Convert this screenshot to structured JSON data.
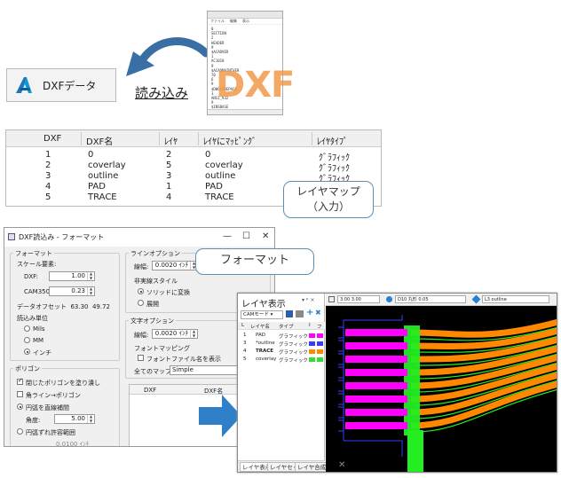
{
  "dxf_button": {
    "label": "DXFデータ"
  },
  "load_label": "読み込み",
  "thumbnail": {
    "menu": [
      "ファイル",
      "編集",
      "表示"
    ],
    "lines": [
      "0",
      "SECTION",
      "2",
      "HEADER",
      "9",
      "$ACADVER",
      "1",
      "AC1018",
      "9",
      "$ACADMAINTVER",
      "70",
      "6",
      "9",
      "$DWGCODEPAGE",
      "3",
      "ANSI_932",
      "9",
      "$INSBASE"
    ],
    "big_text": "DXF"
  },
  "layer_table": {
    "headers": [
      "DXF",
      "DXF名",
      "ﾚｲﾔ",
      "ﾚｲﾔにﾏｯﾋﾟﾝｸﾞ",
      "ﾚｲﾔﾀｲﾌﾟ"
    ],
    "rows": [
      [
        "1",
        "0",
        "2",
        "0",
        "ｸﾞﾗﾌｨｯｸ"
      ],
      [
        "2",
        "coverlay",
        "5",
        "coverlay",
        "ｸﾞﾗﾌｨｯｸ"
      ],
      [
        "3",
        "outline",
        "3",
        "outline",
        "ｸﾞﾗﾌｨｯｸ"
      ],
      [
        "4",
        "PAD",
        "1",
        "PAD",
        "ｸﾞﾗﾌｨｯｸ"
      ],
      [
        "5",
        "TRACE",
        "4",
        "TRACE",
        "ｸﾞﾗﾌｨｯｸ"
      ]
    ]
  },
  "callout_layer_map": {
    "line1": "レイヤマップ",
    "line2": "（入力）"
  },
  "callout_format": {
    "label": "フォーマット"
  },
  "dialog": {
    "title": "DXF読込み - フォーマット",
    "format_group": "フォーマット",
    "scale_factor": "スケール要素:",
    "dxf_label": "DXF:",
    "dxf_value": "1.00",
    "cam_label": "CAM350:",
    "cam_value": "0.23",
    "data_offset_label": "データオフセット",
    "data_offset_x": "63.30",
    "data_offset_y": "49.72",
    "units_label": "読込み単位",
    "unit_mils": "Mils",
    "unit_mm": "MM",
    "unit_inch": "インチ",
    "polygon_group": "ポリゴン",
    "fill_closed": "閉じたポリゴンを塗り潰し",
    "corner_to_poly": "角ライン→ポリゴン",
    "arc_to_line": "円弧を直線補間",
    "angle_label": "角度:",
    "angle_value": "5.00",
    "arc_tolerance": "円弧ずれ許容範囲",
    "arc_tol_value": "0.0100 ｲﾝﾁ",
    "line_option_group": "ラインオプション",
    "line_width_label": "線幅:",
    "line_width_value": "0.0020 ｲﾝﾁ",
    "non_solid_style": "非実線スタイル",
    "convert_solid": "ソリッドに変換",
    "expand": "展開",
    "text_option_group": "文字オプション",
    "text_width_label": "線幅:",
    "text_width_value": "0.0020 ｲﾝﾁ",
    "font_mapping": "フォントマッピング",
    "show_font_name": "フォントファイル名を表示",
    "all_map_label": "全てのマップ先:",
    "all_map_value": "Simple",
    "grid_dxf": "DXF",
    "grid_dxf_name": "DXF名",
    "minimize": "—",
    "maximize": "☐",
    "close": "✕"
  },
  "layer_window": {
    "title": "レイヤ表示",
    "pin": "▾ ᵖ ×",
    "mode": "CAMモード",
    "col_headers": [
      "L",
      "レイヤ名",
      "タイプ",
      "I",
      "フ"
    ],
    "layers": [
      {
        "num": "1",
        "name": "PAD",
        "type": "グラフィック",
        "color1": "#ff00ff",
        "color2": "#ff00ff"
      },
      {
        "num": "3",
        "name": "*outline",
        "type": "グラフィック",
        "color1": "#3b3bff",
        "color2": "#3b3bff"
      },
      {
        "num": "4",
        "name": "TRACE",
        "type": "グラフィック",
        "color1": "#ff8800",
        "color2": "#ff8800"
      },
      {
        "num": "5",
        "name": "coverlay",
        "type": "グラフィック",
        "color1": "#33dd33",
        "color2": "#33dd33"
      }
    ],
    "tabs": [
      "レイヤ表示",
      "レイヤセット",
      "レイヤ合成"
    ],
    "toolbar_zoom": "3.00 3.00",
    "toolbar_dcode": "D10 丸形 0.05",
    "toolbar_layer": "L3 outline"
  },
  "colors": {
    "accent_blue": "#2f7fc9",
    "arrow_blue": "#3a6fa6",
    "pad": "#ff00ff",
    "trace": "#ff8800",
    "coverlay": "#22ee22",
    "outline": "#3b3bff"
  }
}
